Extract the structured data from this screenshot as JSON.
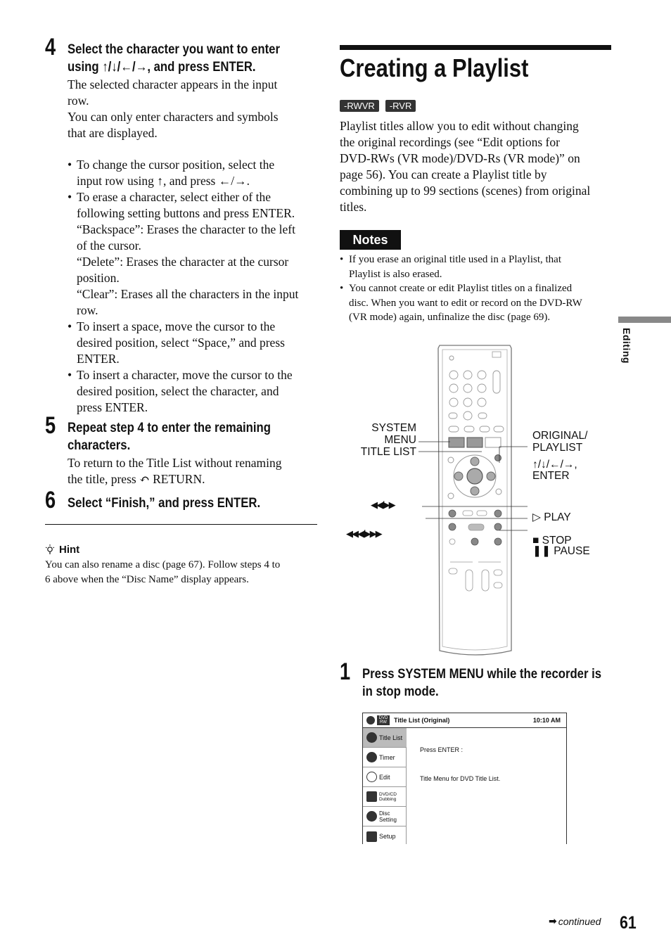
{
  "left": {
    "step4": {
      "number": "4",
      "heading_line1": "Select the character you want to enter",
      "heading_line2": "using ↑/↓/←/→, and press ENTER.",
      "para1_line1": "The selected character appears in the input",
      "para1_line2": "row.",
      "para2_line1": "You can only enter characters and symbols",
      "para2_line2": "that are displayed.",
      "bullets": [
        [
          "To change the cursor position, select the",
          "input row using ↑, and press ←/→."
        ],
        [
          "To erase a character, select either of the",
          "following setting buttons and press ENTER.",
          "“Backspace”: Erases the character to the left",
          "of the cursor.",
          "“Delete”: Erases the character at the cursor",
          "position.",
          "“Clear”: Erases all the characters in the input",
          "row."
        ],
        [
          "To insert a space, move the cursor to the",
          "desired position, select “Space,” and press",
          "ENTER."
        ],
        [
          "To insert a character, move the cursor to the",
          "desired position, select the character, and",
          "press ENTER."
        ]
      ]
    },
    "step5": {
      "number": "5",
      "heading_line1": "Repeat step 4 to enter the remaining",
      "heading_line2": "characters.",
      "para_line1": "To return to the Title List without renaming",
      "para_line2": "the title, press ↶ RETURN."
    },
    "step6": {
      "number": "6",
      "heading": "Select “Finish,” and press ENTER."
    },
    "hint": {
      "icon": "lightbulb-icon",
      "title": "Hint",
      "line1": "You can also rename a disc (page 67). Follow steps 4 to",
      "line2": "6 above when the “Disc Name” display appears."
    }
  },
  "right": {
    "title": "Creating a Playlist",
    "badges": [
      "-RWVR",
      "-RVR"
    ],
    "intro": [
      "Playlist titles allow you to edit without changing",
      "the original recordings (see “Edit options for",
      "DVD-RWs (VR mode)/DVD-Rs (VR mode)” on",
      "page 56). You can create a Playlist title by",
      "combining up to 99 sections (scenes) from original",
      "titles."
    ],
    "notes_label": "Notes",
    "notes": [
      [
        "If you erase an original title used in a Playlist, that",
        "Playlist is also erased."
      ],
      [
        "You cannot create or edit Playlist titles on a finalized",
        "disc. When you want to edit or record on the DVD-RW",
        "(VR mode) again, unfinalize the disc (page 69)."
      ]
    ],
    "remote_labels": {
      "system": "SYSTEM",
      "menu": "MENU",
      "title_list": "TITLE LIST",
      "original": "ORIGINAL/",
      "playlist": "PLAYLIST",
      "arrows": "↑/↓/←/→,",
      "enter": "ENTER",
      "skip": "◀◀/▶▶",
      "scan": "◀◀◀/▶▶▶",
      "play": "▷ PLAY",
      "stop": "■ STOP",
      "pause": "❚❚ PAUSE"
    },
    "step1": {
      "number": "1",
      "heading_line1": "Press SYSTEM MENU while the recorder is",
      "heading_line2": "in stop mode."
    },
    "osd": {
      "disc_label": "DVD RW",
      "header_title": "Title List (Original)",
      "time": "10:10 AM",
      "menu_items": [
        "Title List",
        "Timer",
        "Edit",
        "DVD/CD Dubbing",
        "Disc Setting",
        "Setup"
      ],
      "line1": "Press ENTER :",
      "line2": "Title Menu for DVD Title List."
    }
  },
  "side_tab": "Editing",
  "footer": {
    "continued": "continued",
    "page_number": "61"
  }
}
